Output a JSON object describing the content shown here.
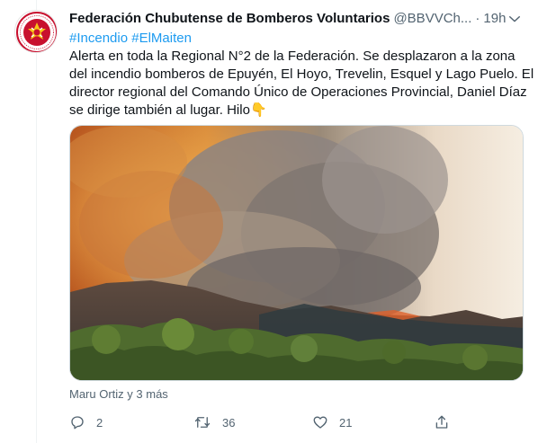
{
  "tweet": {
    "author": {
      "display_name": "Federación Chubutense de Bomberos Voluntarios",
      "handle": "@BBVVCh...",
      "timestamp": "19h",
      "avatar_icon": "firefighter-federation-seal",
      "avatar_ring_text": "FEDERACION DE BOMBEROS VOLUNTARIOS",
      "avatar_bottom_text": "CHUBUT DEL CHUBUT"
    },
    "hashtags": [
      "#Incendio",
      "#ElMaiten"
    ],
    "text_lines": [
      "Alerta en toda la Regional N°2 de la Federación. Se desplazaron a la zona",
      "del incendio bomberos de Epuyén, El Hoyo, Trevelin, Esquel y Lago Puelo. El",
      "director regional del Comando Único de Operaciones Provincial, Daniel Díaz",
      "se dirige también al lugar. Hilo"
    ],
    "emoji": "👇",
    "media": {
      "description_icon": "wildfire-photo",
      "credit": "Maru Ortiz y 3 más"
    },
    "actions": {
      "reply_count": "2",
      "retweet_count": "36",
      "like_count": "21"
    },
    "colors": {
      "accent": "#1d9bf0",
      "secondary_text": "#536471",
      "primary_text": "#0f1419",
      "avatar_red": "#c8102e"
    }
  }
}
